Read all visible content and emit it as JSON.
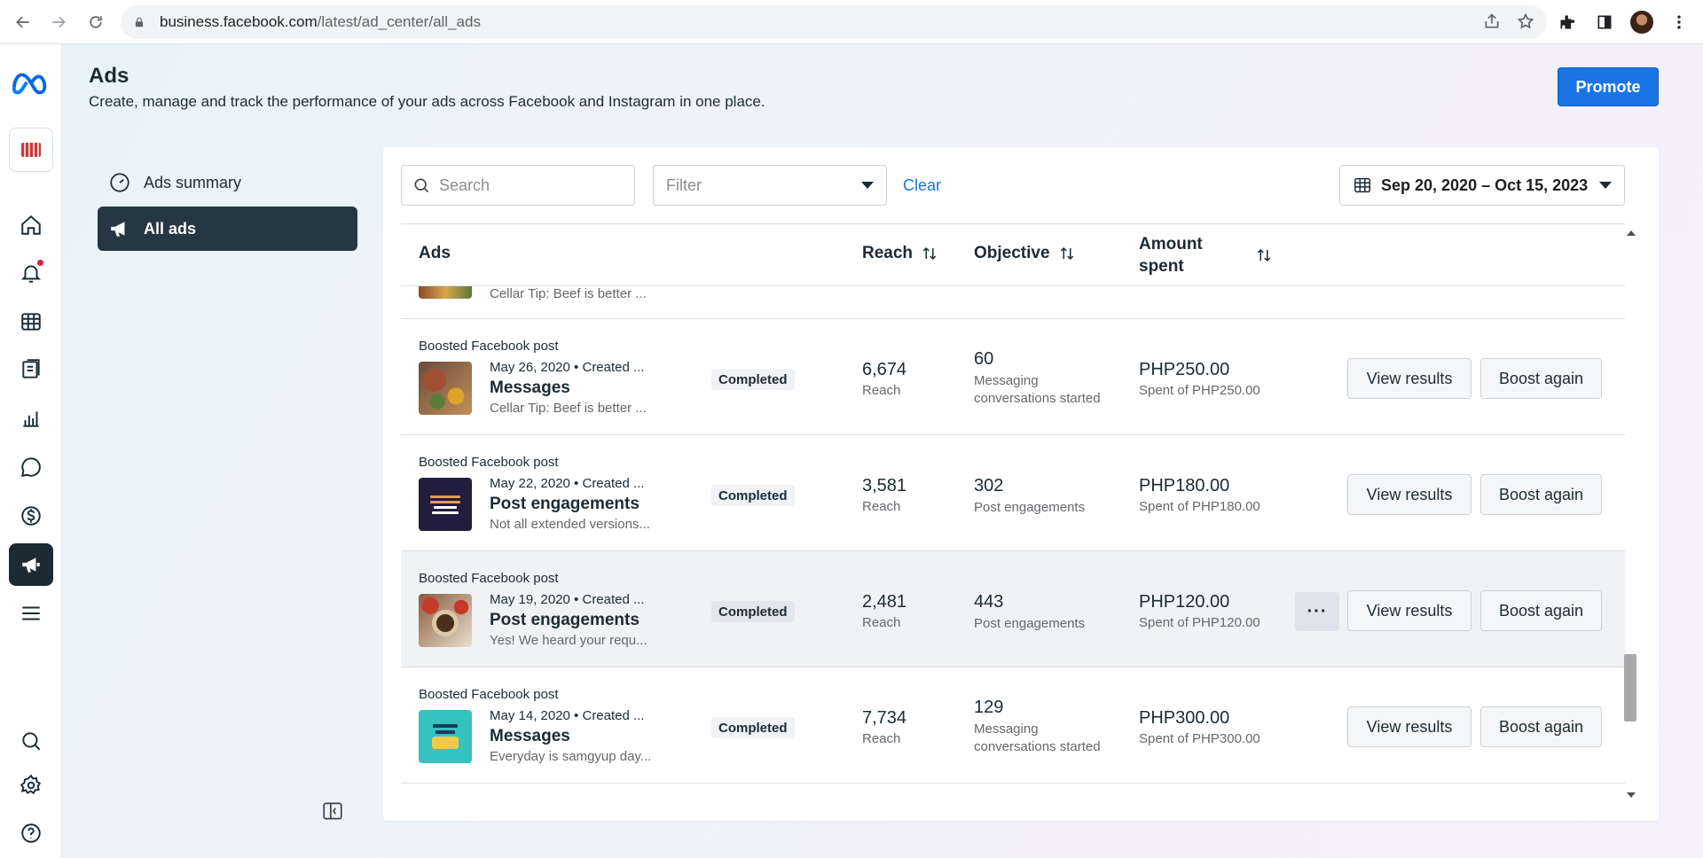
{
  "browser": {
    "url_host": "business.facebook.com",
    "url_path": "/latest/ad_center/all_ads"
  },
  "header": {
    "title": "Ads",
    "description": "Create, manage and track the performance of your ads across Facebook and Instagram in one place.",
    "promote_label": "Promote"
  },
  "sidebar": {
    "items": [
      {
        "label": "Ads summary",
        "icon": "gauge-icon"
      },
      {
        "label": "All ads",
        "icon": "megaphone-icon"
      }
    ]
  },
  "toolbar": {
    "search_placeholder": "Search",
    "filter_placeholder": "Filter",
    "clear_label": "Clear",
    "date_range": "Sep 20, 2020 – Oct 15, 2023"
  },
  "table": {
    "headers": {
      "ads": "Ads",
      "reach": "Reach",
      "objective": "Objective",
      "amount_line1": "Amount",
      "amount_line2": "spent"
    },
    "partial_row_text": "Cellar Tip: Beef is better ...",
    "rows": [
      {
        "type": "Boosted Facebook post",
        "date": "May 26, 2020  •  Created ...",
        "title": "Messages",
        "subtitle": "Cellar Tip: Beef is better ...",
        "status": "Completed",
        "reach": "6,674",
        "reach_label": "Reach",
        "objective_value": "60",
        "objective_label": "Messaging conversations started",
        "amount": "PHP250.00",
        "amount_label": "Spent of PHP250.00",
        "view_label": "View results",
        "boost_label": "Boost again"
      },
      {
        "type": "Boosted Facebook post",
        "date": "May 22, 2020  •  Created ...",
        "title": "Post engagements",
        "subtitle": "Not all extended versions...",
        "status": "Completed",
        "reach": "3,581",
        "reach_label": "Reach",
        "objective_value": "302",
        "objective_label": "Post engagements",
        "amount": "PHP180.00",
        "amount_label": "Spent of PHP180.00",
        "view_label": "View results",
        "boost_label": "Boost again"
      },
      {
        "type": "Boosted Facebook post",
        "date": "May 19, 2020  •  Created ...",
        "title": "Post engagements",
        "subtitle": "Yes! We heard your requ...",
        "status": "Completed",
        "reach": "2,481",
        "reach_label": "Reach",
        "objective_value": "443",
        "objective_label": "Post engagements",
        "amount": "PHP120.00",
        "amount_label": "Spent of PHP120.00",
        "more_label": "···",
        "view_label": "View results",
        "boost_label": "Boost again"
      },
      {
        "type": "Boosted Facebook post",
        "date": "May 14, 2020  •  Created ...",
        "title": "Messages",
        "subtitle": "Everyday is samgyup day...",
        "status": "Completed",
        "reach": "7,734",
        "reach_label": "Reach",
        "objective_value": "129",
        "objective_label": "Messaging conversations started",
        "amount": "PHP300.00",
        "amount_label": "Spent of PHP300.00",
        "view_label": "View results",
        "boost_label": "Boost again"
      }
    ]
  },
  "colors": {
    "accent": "#1b74e4",
    "active_nav": "#263744",
    "rail_active": "#1c2b33"
  }
}
